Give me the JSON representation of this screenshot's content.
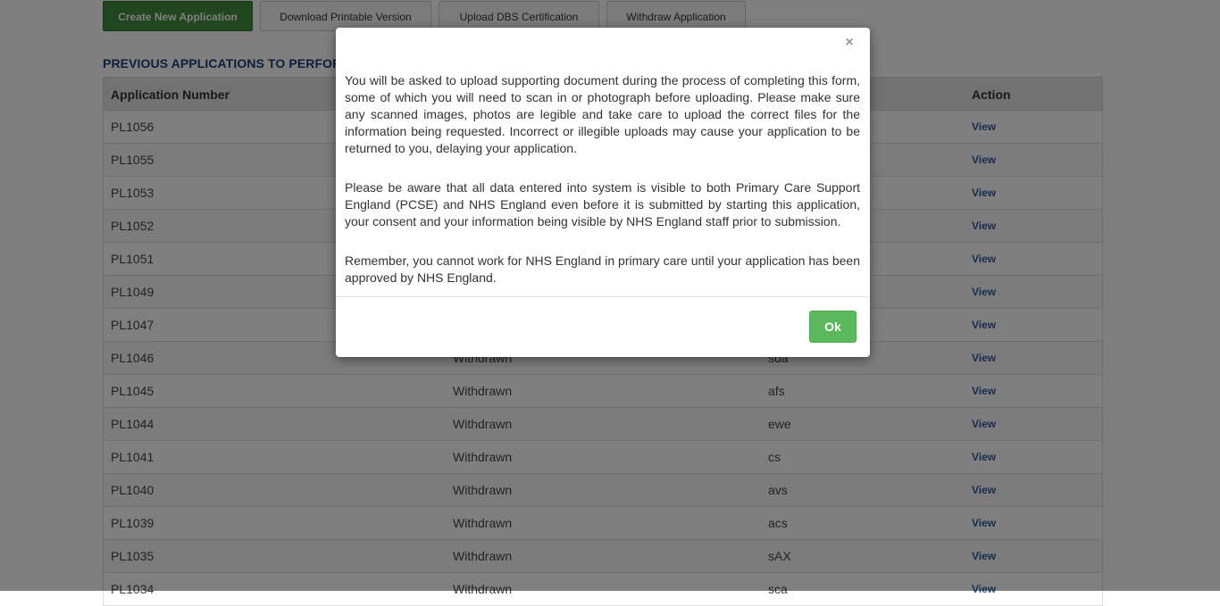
{
  "toolbar": {
    "buttons": [
      {
        "label": "Create New Application"
      },
      {
        "label": "Download Printable Version"
      },
      {
        "label": "Upload DBS Certification"
      },
      {
        "label": "Withdraw Application"
      }
    ]
  },
  "section_title": "PREVIOUS APPLICATIONS TO PERFOR",
  "table": {
    "headers": [
      "Application Number",
      "",
      "",
      "Action"
    ],
    "rows": [
      {
        "number": "PL1056",
        "status": "",
        "name": "",
        "action": "View"
      },
      {
        "number": "PL1055",
        "status": "",
        "name": "",
        "action": "View"
      },
      {
        "number": "PL1053",
        "status": "",
        "name": "",
        "action": "View"
      },
      {
        "number": "PL1052",
        "status": "",
        "name": "",
        "action": "View"
      },
      {
        "number": "PL1051",
        "status": "",
        "name": "",
        "action": "View"
      },
      {
        "number": "PL1049",
        "status": "",
        "name": "",
        "action": "View"
      },
      {
        "number": "PL1047",
        "status": "",
        "name": "",
        "action": "View"
      },
      {
        "number": "PL1046",
        "status": "Withdrawn",
        "name": "sda",
        "action": "View"
      },
      {
        "number": "PL1045",
        "status": "Withdrawn",
        "name": "afs",
        "action": "View"
      },
      {
        "number": "PL1044",
        "status": "Withdrawn",
        "name": "ewe",
        "action": "View"
      },
      {
        "number": "PL1041",
        "status": "Withdrawn",
        "name": "cs",
        "action": "View"
      },
      {
        "number": "PL1040",
        "status": "Withdrawn",
        "name": "avs",
        "action": "View"
      },
      {
        "number": "PL1039",
        "status": "Withdrawn",
        "name": "acs",
        "action": "View"
      },
      {
        "number": "PL1035",
        "status": "Withdrawn",
        "name": "sAX",
        "action": "View"
      },
      {
        "number": "PL1034",
        "status": "Withdrawn",
        "name": "sca",
        "action": "View"
      }
    ]
  },
  "modal": {
    "close_symbol": "×",
    "paragraphs": [
      "You will be asked to upload supporting document during the process of completing this form, some of which you will need to scan in or photograph before uploading. Please make sure any scanned images, photos are legible and take care to upload the correct files for the information being requested. Incorrect or illegible uploads may cause your application to be returned to you, delaying your application.",
      "Please be aware that all data entered into system is visible to both Primary Care Support England (PCSE) and NHS England even before it is submitted by starting this application, your consent and your information being visible by NHS England staff prior to submission.",
      "Remember, you cannot work for NHS England in primary care until your application has been approved by NHS England."
    ],
    "ok_label": "Ok"
  },
  "colors": {
    "primary_button": "#3f8d3f",
    "section_title": "#1e3f77",
    "link": "#2a5aa0",
    "ok_button": "#5cb85c"
  }
}
